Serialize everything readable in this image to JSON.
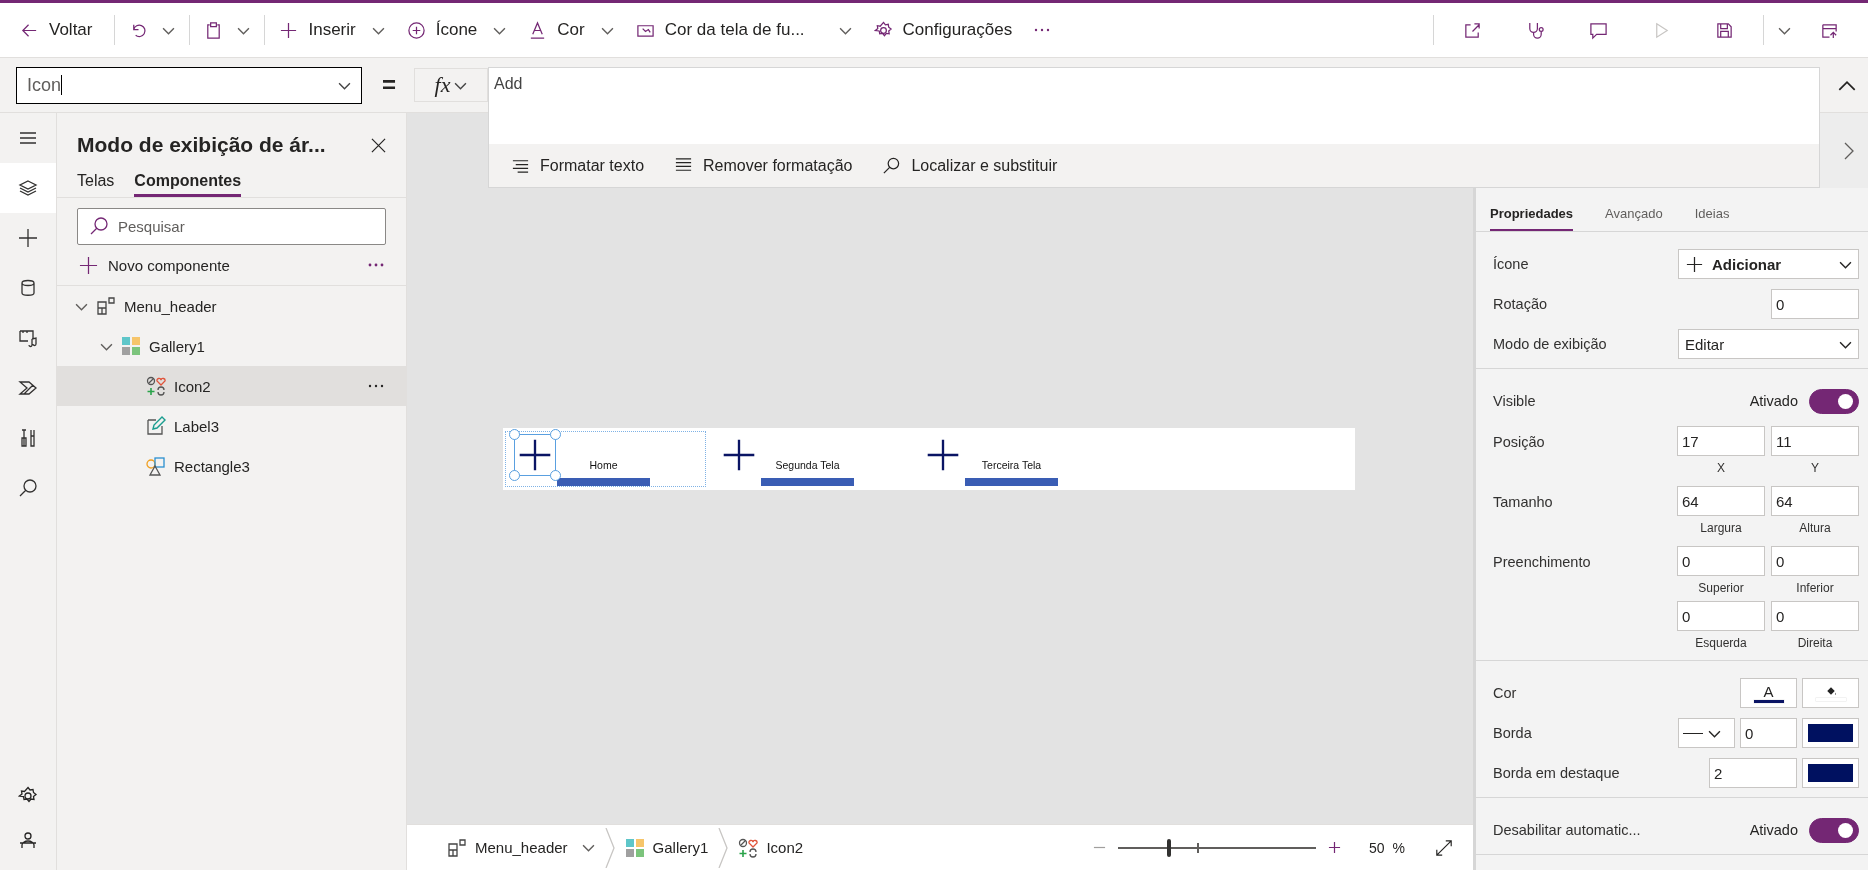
{
  "toolbar": {
    "back": "Voltar",
    "insert": "Inserir",
    "icon": "Ícone",
    "color_label": "Cor",
    "screen_color": "Cor da tela de fu...",
    "settings": "Configurações",
    "play_disabled": true
  },
  "formula": {
    "property": "Icon",
    "equals": "=",
    "fx": "fx",
    "value": "Add",
    "tools": [
      "Formatar texto",
      "Remover formatação",
      "Localizar e substituir"
    ]
  },
  "rail": [
    {
      "selected": false
    },
    {
      "selected": true
    },
    {
      "selected": false
    },
    {
      "selected": false
    },
    {
      "selected": false
    },
    {
      "selected": false
    },
    {
      "selected": false
    },
    {
      "selected": false
    }
  ],
  "tree_view": {
    "title": "Modo de exibição de ár...",
    "tabs": [
      {
        "label": "Telas",
        "selected": false
      },
      {
        "label": "Componentes",
        "selected": true
      }
    ],
    "search": {
      "placeholder": "Pesquisar"
    },
    "new_component": "Novo componente",
    "tree": [
      {
        "kind": "component",
        "label": "Menu_header",
        "expanded": true,
        "selected": false,
        "children": [
          {
            "kind": "gallery",
            "label": "Gallery1",
            "expanded": true,
            "selected": false,
            "children": [
              {
                "kind": "icon",
                "label": "Icon2",
                "selected": true
              },
              {
                "kind": "label",
                "label": "Label3",
                "selected": false
              },
              {
                "kind": "rectangle",
                "label": "Rectangle3",
                "selected": false
              }
            ]
          }
        ]
      }
    ]
  },
  "canvas": {
    "gallery": [
      {
        "label": "Home",
        "selected": true
      },
      {
        "label": "Segunda Tela",
        "selected": false
      },
      {
        "label": "Terceira Tela",
        "selected": false
      }
    ]
  },
  "status_bar": {
    "breadcrumbs": [
      {
        "kind": "component",
        "label": "Menu_header"
      },
      {
        "kind": "gallery",
        "label": "Gallery1"
      },
      {
        "kind": "icon",
        "label": "Icon2"
      }
    ],
    "zoom": {
      "level": 0.26,
      "value": "50",
      "unit": "%"
    }
  },
  "properties": {
    "tabs": [
      {
        "label": "Propriedades",
        "selected": true
      },
      {
        "label": "Avançado",
        "selected": false
      },
      {
        "label": "Ideias",
        "selected": false
      }
    ],
    "sections": [
      {
        "rows": [
          {
            "kind": "picker",
            "label": "Ícone",
            "value": "Adicionar"
          },
          {
            "kind": "number",
            "label": "Rotação",
            "value": "0"
          },
          {
            "kind": "dropdown",
            "label": "Modo de exibição",
            "value": "Editar"
          }
        ]
      },
      {
        "rows": [
          {
            "kind": "toggle",
            "label": "Visible",
            "state": "Ativado",
            "on": true
          },
          {
            "kind": "fields",
            "label": "Posição",
            "fields": [
              {
                "value": "17",
                "caption": "X"
              },
              {
                "value": "11",
                "caption": "Y"
              }
            ]
          },
          {
            "kind": "fields",
            "label": "Tamanho",
            "fields": [
              {
                "value": "64",
                "caption": "Largura"
              },
              {
                "value": "64",
                "caption": "Altura"
              }
            ]
          },
          {
            "kind": "fields",
            "label": "Preenchimento",
            "fields": [
              {
                "value": "0",
                "caption": "Superior"
              },
              {
                "value": "0",
                "caption": "Inferior"
              },
              {
                "value": "0",
                "caption": "Esquerda"
              },
              {
                "value": "0",
                "caption": "Direita"
              }
            ]
          }
        ]
      },
      {
        "rows": [
          {
            "kind": "colors",
            "label": "Cor",
            "glyph": "A",
            "swatches": [
              {
                "color": "#0a1464"
              },
              {
                "color": "#ffffff"
              }
            ]
          },
          {
            "kind": "border",
            "label": "Borda",
            "value": "0",
            "color": "#001160"
          },
          {
            "kind": "number-swatch",
            "label": "Borda em destaque",
            "value": "2",
            "color": "#001160"
          }
        ]
      },
      {
        "rows": [
          {
            "kind": "toggle",
            "label": "Desabilitar automatic...",
            "state": "Ativado",
            "on": true
          }
        ]
      }
    ]
  }
}
